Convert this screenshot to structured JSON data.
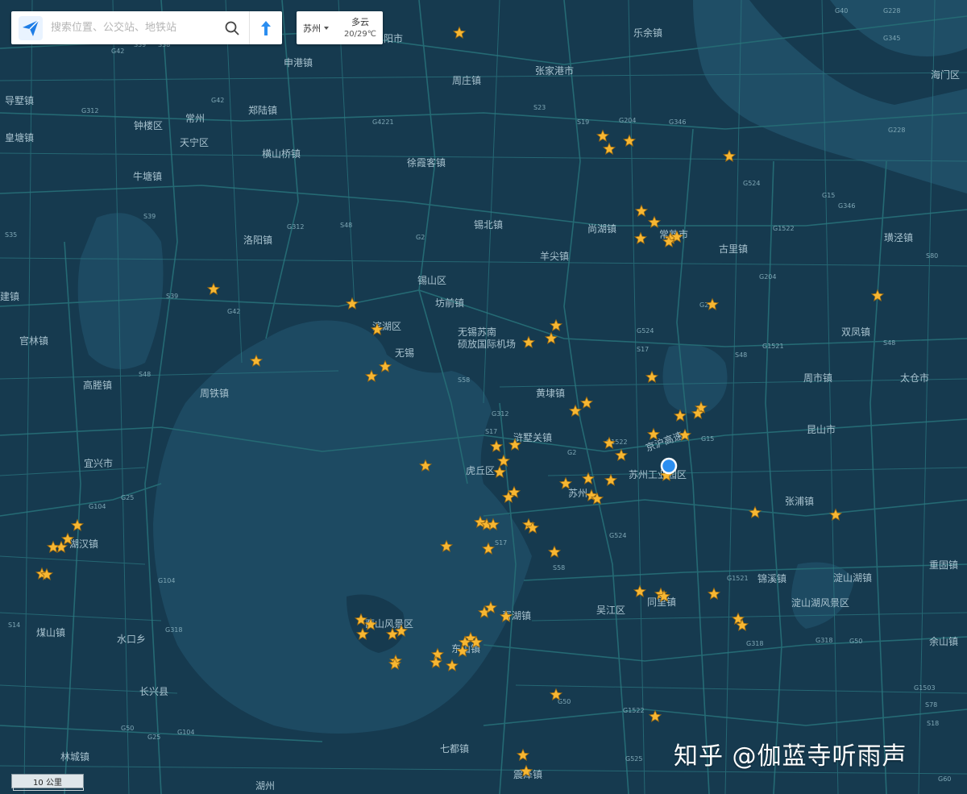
{
  "search": {
    "placeholder": "搜索位置、公交站、地铁站"
  },
  "weather": {
    "city": "苏州",
    "condition": "多云",
    "temp": "20/29℃"
  },
  "scale": {
    "label": "10 公里"
  },
  "watermark": "知乎 @伽蓝寺听雨声",
  "icons": {
    "logo": "paper-plane-icon",
    "search": "magnifier-icon",
    "route": "route-arrow-icon",
    "city_dropdown": "caret-down-icon",
    "location": "current-location-dot"
  },
  "colors": {
    "land": "#163a4f",
    "water": "#1d4a62",
    "road": "#256a74",
    "star": "#f7b733",
    "location": "#2b8ef0"
  },
  "places": [
    {
      "id": "yangshe",
      "text": "阳市"
    },
    {
      "id": "leyu",
      "text": "乐余镇"
    },
    {
      "id": "zhouzhuang_n",
      "text": "周庄镇"
    },
    {
      "id": "zhangjiagang",
      "text": "张家港市"
    },
    {
      "id": "shenggang",
      "text": "申港镇"
    },
    {
      "id": "daoguan",
      "text": "导墅镇"
    },
    {
      "id": "zhenglu",
      "text": "郑陆镇"
    },
    {
      "id": "changzhou",
      "text": "常州"
    },
    {
      "id": "zhonglou",
      "text": "钟楼区"
    },
    {
      "id": "tianning",
      "text": "天宁区"
    },
    {
      "id": "huangtang",
      "text": "皇塘镇"
    },
    {
      "id": "hengshanqiao",
      "text": "横山桥镇"
    },
    {
      "id": "xuxiake",
      "text": "徐霞客镇"
    },
    {
      "id": "niutang",
      "text": "牛塘镇"
    },
    {
      "id": "xibei",
      "text": "锡北镇"
    },
    {
      "id": "shanghu",
      "text": "尚湖镇"
    },
    {
      "id": "changshu",
      "text": "常熟市"
    },
    {
      "id": "guli",
      "text": "古里镇"
    },
    {
      "id": "zhilu",
      "text": "璜泾镇"
    },
    {
      "id": "luoyang",
      "text": "洛阳镇"
    },
    {
      "id": "yangjian",
      "text": "羊尖镇"
    },
    {
      "id": "xishan",
      "text": "锡山区"
    },
    {
      "id": "fangqian",
      "text": "坊前镇"
    },
    {
      "id": "binhu",
      "text": "滨湖区"
    },
    {
      "id": "wuxi",
      "text": "无锡"
    },
    {
      "id": "airport",
      "text": "无锡苏南\n硕放国际机场"
    },
    {
      "id": "shuangfeng",
      "text": "双凤镇"
    },
    {
      "id": "guanlin",
      "text": "官林镇"
    },
    {
      "id": "jian",
      "text": "建镇"
    },
    {
      "id": "gaocheng",
      "text": "高塍镇"
    },
    {
      "id": "zhoutie",
      "text": "周铁镇"
    },
    {
      "id": "huangdai",
      "text": "黄埭镇"
    },
    {
      "id": "zhoushi",
      "text": "周市镇"
    },
    {
      "id": "taicang",
      "text": "太仓市"
    },
    {
      "id": "xushuguan",
      "text": "浒墅关镇"
    },
    {
      "id": "yixing",
      "text": "宜兴市"
    },
    {
      "id": "huqiu",
      "text": "虎丘区"
    },
    {
      "id": "suzhou",
      "text": "苏州"
    },
    {
      "id": "sip",
      "text": "苏州工业园区"
    },
    {
      "id": "kunshan",
      "text": "昆山市"
    },
    {
      "id": "zhangpu",
      "text": "张浦镇"
    },
    {
      "id": "jinghu",
      "text": "京沪高速"
    },
    {
      "id": "dingshu",
      "text": "湖汉镇"
    },
    {
      "id": "chongde",
      "text": "重固镇"
    },
    {
      "id": "dianshan",
      "text": "淀山湖镇"
    },
    {
      "id": "jinxi",
      "text": "锦溪镇"
    },
    {
      "id": "dianshanfj",
      "text": "淀山湖风景区"
    },
    {
      "id": "wujiang",
      "text": "吴江区"
    },
    {
      "id": "tongli",
      "text": "同里镇"
    },
    {
      "id": "xishanfj",
      "text": "西山风景区"
    },
    {
      "id": "dongshan",
      "text": "东山镇"
    },
    {
      "id": "xukou",
      "text": "胥湖镇"
    },
    {
      "id": "meishan",
      "text": "煤山镇"
    },
    {
      "id": "shuikou",
      "text": "水口乡"
    },
    {
      "id": "yuzhu",
      "text": "余山镇"
    },
    {
      "id": "changxing",
      "text": "长兴县"
    },
    {
      "id": "lincheng",
      "text": "林城镇"
    },
    {
      "id": "qidu",
      "text": "七都镇"
    },
    {
      "id": "huzhou",
      "text": "湖州"
    },
    {
      "id": "zhenze",
      "text": "震泽镇"
    },
    {
      "id": "haimen",
      "text": "海门区"
    }
  ],
  "highways": [
    "G40",
    "G228",
    "G345",
    "G42",
    "S39",
    "S38",
    "G312",
    "G4221",
    "S23",
    "S19",
    "G204",
    "G346",
    "G228",
    "G42",
    "S39",
    "S35",
    "G312",
    "S48",
    "G2",
    "G15",
    "G524",
    "G1522",
    "G346",
    "S80",
    "S48",
    "G204",
    "S39",
    "G524",
    "S17",
    "G1521",
    "G42",
    "G22",
    "S48",
    "S58",
    "G312",
    "S17",
    "G2",
    "G1522",
    "G15",
    "S48",
    "G104",
    "G25",
    "G104",
    "S14",
    "G318",
    "G50",
    "G25",
    "G104",
    "S58",
    "G1521",
    "S17",
    "G524",
    "G50",
    "G318",
    "G1503",
    "G1522",
    "S18",
    "G60",
    "G50",
    "G318",
    "S78",
    "G525"
  ],
  "stars_count": 98,
  "location": {
    "label": "current-location"
  }
}
